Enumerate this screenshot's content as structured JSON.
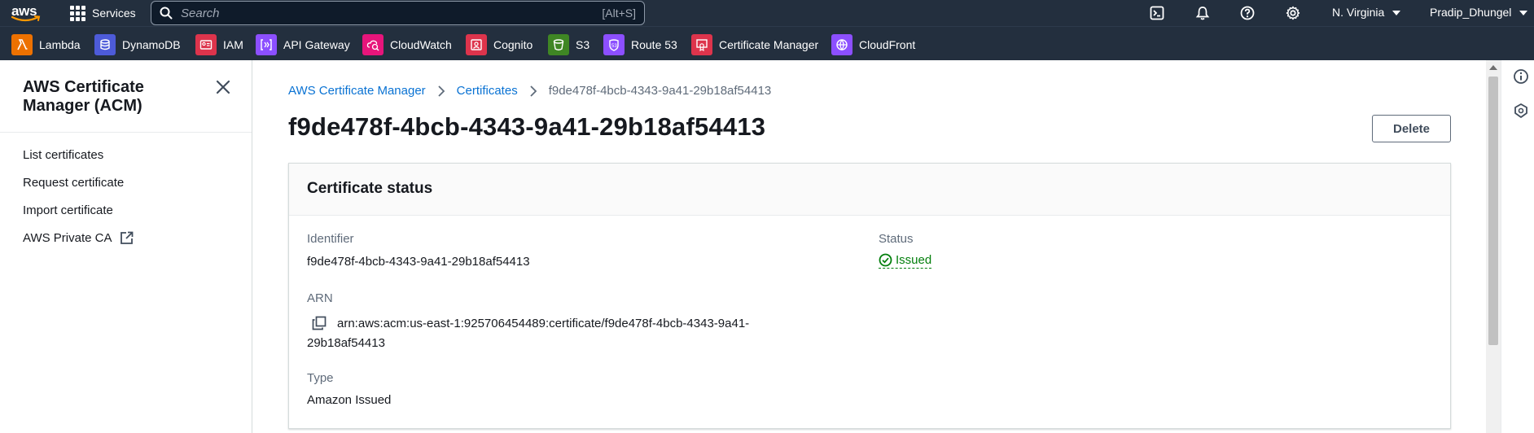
{
  "topnav": {
    "logo_text": "aws",
    "services_label": "Services",
    "search_placeholder": "Search",
    "search_shortcut": "[Alt+S]",
    "region": "N. Virginia",
    "user": "Pradip_Dhungel",
    "icons": [
      "cloudshell-icon",
      "bell-icon",
      "help-icon",
      "settings-icon"
    ]
  },
  "favorites": [
    {
      "label": "Lambda",
      "color": "#ed7100",
      "icon": "lambda-icon"
    },
    {
      "label": "DynamoDB",
      "color": "#4d5bd9",
      "icon": "dynamodb-icon"
    },
    {
      "label": "IAM",
      "color": "#dd344c",
      "icon": "iam-icon"
    },
    {
      "label": "API Gateway",
      "color": "#8c4fff",
      "icon": "api-gateway-icon"
    },
    {
      "label": "CloudWatch",
      "color": "#e7157b",
      "icon": "cloudwatch-icon"
    },
    {
      "label": "Cognito",
      "color": "#dd344c",
      "icon": "cognito-icon"
    },
    {
      "label": "S3",
      "color": "#3f8624",
      "icon": "s3-icon"
    },
    {
      "label": "Route 53",
      "color": "#8c4fff",
      "icon": "route53-icon"
    },
    {
      "label": "Certificate Manager",
      "color": "#dd344c",
      "icon": "certificate-manager-icon"
    },
    {
      "label": "CloudFront",
      "color": "#8c4fff",
      "icon": "cloudfront-icon"
    }
  ],
  "sidenav": {
    "title": "AWS Certificate Manager (ACM)",
    "items": [
      {
        "label": "List certificates"
      },
      {
        "label": "Request certificate"
      },
      {
        "label": "Import certificate"
      },
      {
        "label": "AWS Private CA",
        "external": true
      }
    ]
  },
  "breadcrumbs": [
    {
      "label": "AWS Certificate Manager"
    },
    {
      "label": "Certificates"
    },
    {
      "label": "f9de478f-4bcb-4343-9a41-29b18af54413"
    }
  ],
  "page": {
    "title": "f9de478f-4bcb-4343-9a41-29b18af54413",
    "delete_label": "Delete"
  },
  "certificate_status": {
    "heading": "Certificate status",
    "identifier_label": "Identifier",
    "identifier_value": "f9de478f-4bcb-4343-9a41-29b18af54413",
    "status_label": "Status",
    "status_value": "Issued",
    "status_color": "#037f0c",
    "arn_label": "ARN",
    "arn_value": "arn:aws:acm:us-east-1:925706454489:certificate/f9de478f-4bcb-4343-9a41-29b18af54413",
    "type_label": "Type",
    "type_value": "Amazon Issued"
  },
  "colors": {
    "nav_bg": "#232f3e",
    "link": "#0972d3",
    "text": "#16191f",
    "muted": "#5f6b7a"
  }
}
